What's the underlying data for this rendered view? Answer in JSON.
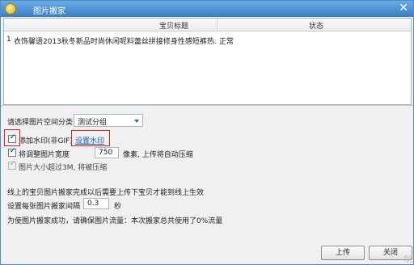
{
  "window": {
    "title": "图片搬家",
    "close_label": "✕"
  },
  "table": {
    "columns": [
      "宝贝标题",
      "状态"
    ],
    "rows": [
      {
        "index": "1",
        "title": "衣饰馨语2013秋冬新品时尚休闲呢料蕾丝拼接修身性感短裤热...",
        "status": "正常"
      }
    ]
  },
  "options": {
    "category_label": "请选择图片空间分类",
    "category_value": "测试分组",
    "watermark_label": "添加水印(非GIF)",
    "watermark_checked": true,
    "watermark_link": "设置水印",
    "resize_label": "将调整图片宽度",
    "resize_width": "750",
    "resize_suffix": "像素, 上传将自动压缩",
    "resize_checked": true,
    "size_limit_label": "图片大小超过3M, 将被压缩",
    "size_limit_checked": true,
    "size_limit_disabled": true
  },
  "notes": {
    "line1": "线上的宝贝图片搬家完成以后需要上传下宝贝才能到线上生效",
    "interval_label": "设置每张图片搬家间隔",
    "interval_value": "0.3",
    "interval_unit": "秒",
    "line3": "为使图片搬家成功，请确保图片流量：本次搬家总共使用了0%流量"
  },
  "buttons": {
    "upload": "上传",
    "close": "关闭"
  }
}
